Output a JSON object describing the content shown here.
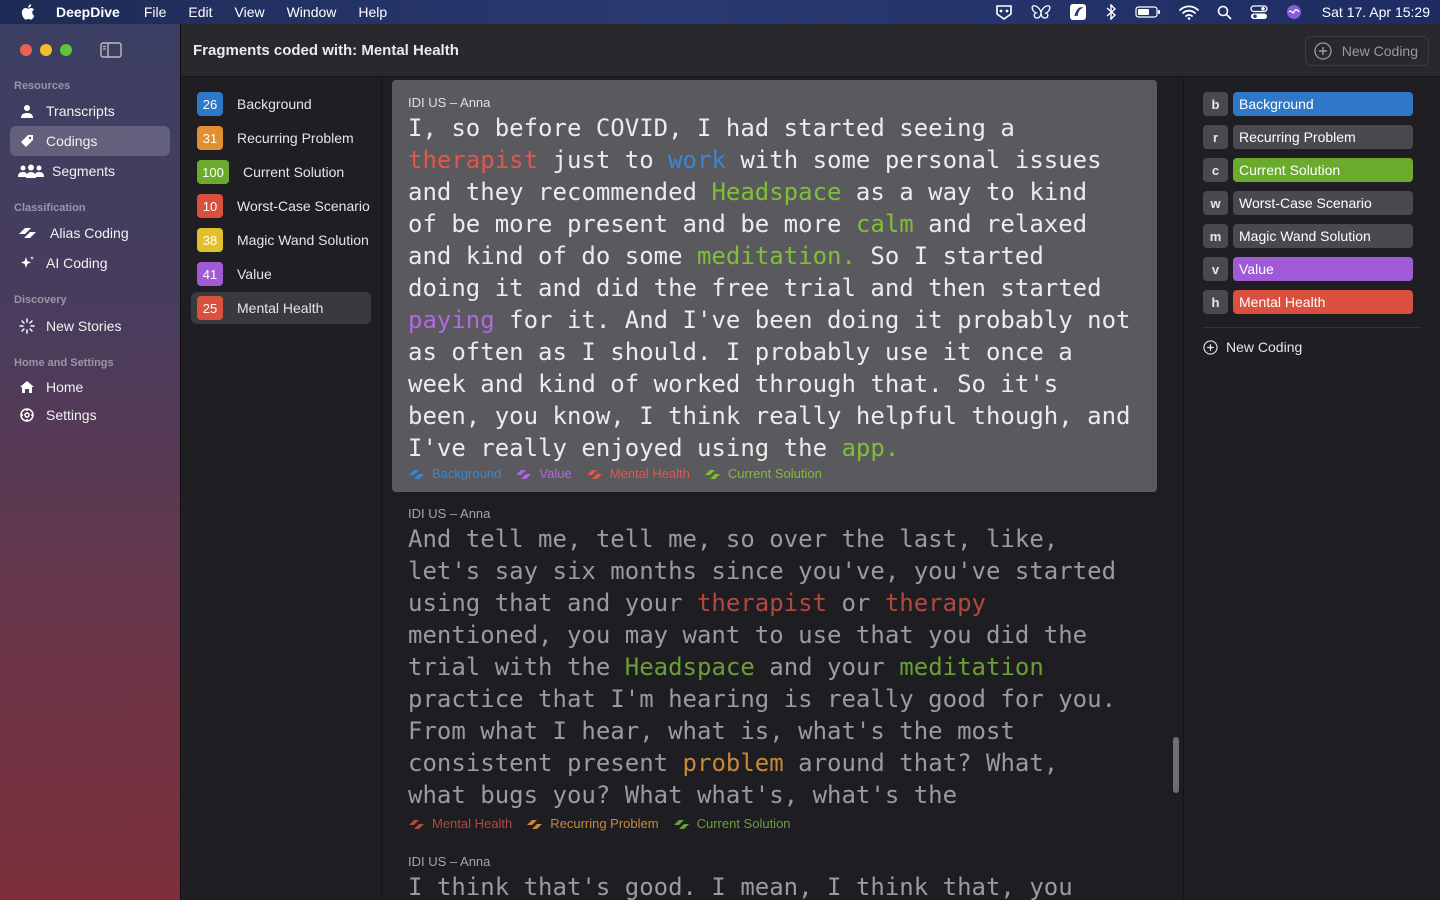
{
  "menubar": {
    "app_name": "DeepDive",
    "menus": [
      "File",
      "Edit",
      "View",
      "Window",
      "Help"
    ],
    "clock": "Sat 17. Apr  15:29"
  },
  "sidebar": {
    "sections": [
      {
        "label": "Resources",
        "items": [
          {
            "label": "Transcripts",
            "icon": "person-icon"
          },
          {
            "label": "Codings",
            "icon": "tag-icon",
            "selected": true
          },
          {
            "label": "Segments",
            "icon": "people-icon"
          }
        ]
      },
      {
        "label": "Classification",
        "items": [
          {
            "label": "Alias Coding",
            "icon": "alias-icon"
          },
          {
            "label": "AI Coding",
            "icon": "sparkle-icon"
          }
        ]
      },
      {
        "label": "Discovery",
        "items": [
          {
            "label": "New Stories",
            "icon": "burst-icon"
          }
        ]
      },
      {
        "label": "Home and Settings",
        "items": [
          {
            "label": "Home",
            "icon": "house-icon"
          },
          {
            "label": "Settings",
            "icon": "gear-icon"
          }
        ]
      }
    ]
  },
  "header": {
    "title": "Fragments coded with: Mental Health",
    "new_coding_label": "New Coding"
  },
  "codes": [
    {
      "count": "26",
      "label": "Background",
      "color": "#2f78c8"
    },
    {
      "count": "31",
      "label": "Recurring Problem",
      "color": "#e0902e"
    },
    {
      "count": "100",
      "label": "Current Solution",
      "color": "#6aab2e"
    },
    {
      "count": "10",
      "label": "Worst-Case Scenario",
      "color": "#d9503f"
    },
    {
      "count": "38",
      "label": "Magic Wand Solution",
      "color": "#e1c02a"
    },
    {
      "count": "41",
      "label": "Value",
      "color": "#a15ad6"
    },
    {
      "count": "25",
      "label": "Mental Health",
      "color": "#d9503f",
      "selected": true
    }
  ],
  "fragments": [
    {
      "source": "IDI US – Anna",
      "segments": [
        {
          "t": "I, so before COVID, I had started seeing a\n"
        },
        {
          "t": "therapist",
          "c": "c-mh"
        },
        {
          "t": " just to "
        },
        {
          "t": "work",
          "c": "c-bg"
        },
        {
          "t": " with some personal issues\nand they recommended "
        },
        {
          "t": "Headspace",
          "c": "c-cs"
        },
        {
          "t": " as a way to kind\nof be more present and be more "
        },
        {
          "t": "calm",
          "c": "c-cs"
        },
        {
          "t": " and relaxed\nand kind of do some "
        },
        {
          "t": "meditation.",
          "c": "c-cs"
        },
        {
          "t": " So I started\ndoing it and did the free trial and then started\n"
        },
        {
          "t": "paying",
          "c": "c-val"
        },
        {
          "t": " for it. And I've been doing it probably not\nas often as I should. I probably use it once a\nweek and kind of worked through that. So it's\nbeen, you know, I think really helpful though, and\nI've really enjoyed using the "
        },
        {
          "t": "app.",
          "c": "c-cs"
        }
      ],
      "tags": [
        {
          "label": "Background",
          "c": "c-bg",
          "color": "#3a86d4"
        },
        {
          "label": "Value",
          "c": "c-val",
          "color": "#b367e0"
        },
        {
          "label": "Mental Health",
          "c": "c-mh",
          "color": "#e2574a"
        },
        {
          "label": "Current Solution",
          "c": "c-cs",
          "color": "#7fbf3a"
        }
      ]
    },
    {
      "source": "IDI US – Anna",
      "segments": [
        {
          "t": "And tell me, tell me, so over the last, like,\nlet's say six months since you've, you've started\nusing that and your "
        },
        {
          "t": "therapist",
          "c": "c-mh"
        },
        {
          "t": " or "
        },
        {
          "t": "therapy",
          "c": "c-mh"
        },
        {
          "t": "\nmentioned, you may want to use that you did the\ntrial with the "
        },
        {
          "t": "Headspace",
          "c": "c-cs"
        },
        {
          "t": " and your "
        },
        {
          "t": "meditation",
          "c": "c-cs"
        },
        {
          "t": "\npractice that I'm hearing is really good for you.\nFrom what I hear, what is, what's the most\nconsistent present "
        },
        {
          "t": "problem",
          "c": "c-rp"
        },
        {
          "t": " around that? What,\nwhat bugs you? What what's, what's the"
        }
      ],
      "tags": [
        {
          "label": "Mental Health",
          "c": "c-mh",
          "color": "#b3483e"
        },
        {
          "label": "Recurring Problem",
          "c": "c-rp",
          "color": "#c88838"
        },
        {
          "label": "Current Solution",
          "c": "c-cs",
          "color": "#6b9f35"
        }
      ]
    },
    {
      "source": "IDI US – Anna",
      "segments": [
        {
          "t": "I think that's good. I mean, I think that, you"
        }
      ],
      "tags": []
    }
  ],
  "right_codes": [
    {
      "key": "b",
      "label": "Background",
      "color": "#2f78c8"
    },
    {
      "key": "r",
      "label": "Recurring Problem",
      "color": "#4a494e"
    },
    {
      "key": "c",
      "label": "Current Solution",
      "color": "#6aab2e"
    },
    {
      "key": "w",
      "label": "Worst-Case Scenario",
      "color": "#4a494e"
    },
    {
      "key": "m",
      "label": "Magic Wand Solution",
      "color": "#4a494e"
    },
    {
      "key": "v",
      "label": "Value",
      "color": "#a15ad6"
    },
    {
      "key": "h",
      "label": "Mental Health",
      "color": "#d9503f"
    }
  ],
  "right_new_coding_label": "New Coding"
}
